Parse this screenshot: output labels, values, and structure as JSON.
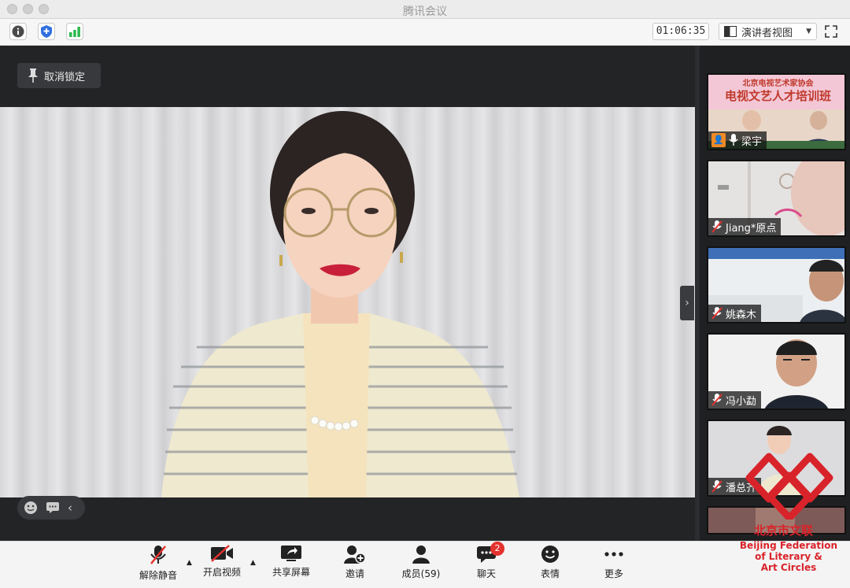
{
  "window": {
    "title": "腾讯会议"
  },
  "toolbar": {
    "timer": "01:06:35",
    "view_label": "演讲者视图"
  },
  "stage": {
    "unpin_label": "取消锁定"
  },
  "participants": [
    {
      "name": "梁宇",
      "muted": false,
      "banner_line1": "北京电视艺术家协会",
      "banner_line2": "电视文艺人才培训班"
    },
    {
      "name": "Jiang*原点",
      "muted": true
    },
    {
      "name": "姚森木",
      "muted": true
    },
    {
      "name": "冯小勐",
      "muted": true
    },
    {
      "name": "潘总齐",
      "muted": true
    }
  ],
  "controls": {
    "unmute": "解除静音",
    "start_video": "开启视频",
    "share_screen": "共享屏幕",
    "invite": "邀请",
    "members": "成员(59)",
    "chat": "聊天",
    "chat_badge": "2",
    "reactions": "表情",
    "more": "更多"
  },
  "watermark": {
    "name_cn": "北京市文联",
    "name_en_1": "Beijing Federation",
    "name_en_2": "of Literary &",
    "name_en_3": "Art Circles"
  },
  "colors": {
    "brand_red": "#d9232a",
    "badge_red": "#e5322e",
    "mic_green": "#2db84c"
  }
}
